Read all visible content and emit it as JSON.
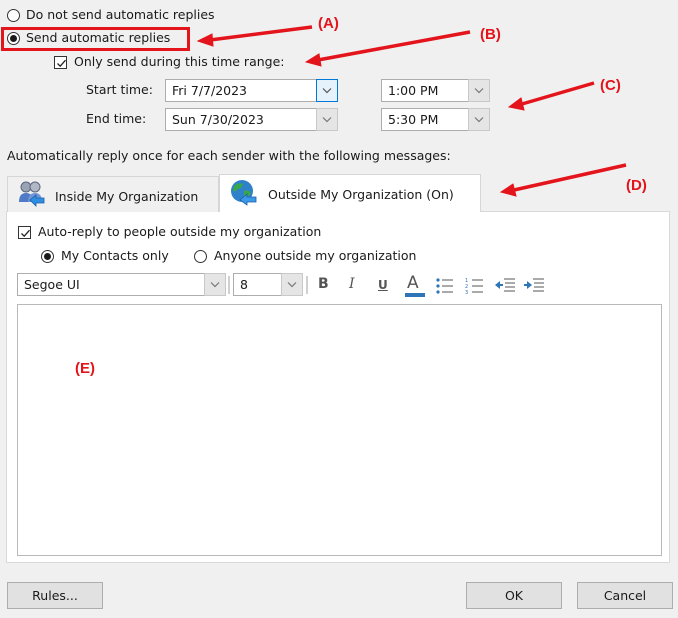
{
  "reply_mode": {
    "options": [
      {
        "label": "Do not send automatic replies",
        "selected": false
      },
      {
        "label": "Send automatic replies",
        "selected": true
      }
    ],
    "time_range": {
      "label": "Only send during this time range:",
      "checked": true,
      "start": {
        "label": "Start time:",
        "date": "Fri 7/7/2023",
        "time": "1:00 PM"
      },
      "end": {
        "label": "End time:",
        "date": "Sun 7/30/2023",
        "time": "5:30 PM"
      }
    }
  },
  "messages_label": "Automatically reply once for each sender with the following messages:",
  "tabs": [
    {
      "label": "Inside My Organization",
      "icon": "people-icon",
      "active": false
    },
    {
      "label": "Outside My Organization (On)",
      "icon": "globe-icon",
      "active": true
    }
  ],
  "outside": {
    "auto_reply_label": "Auto-reply to people outside my organization",
    "auto_reply_checked": true,
    "audience": [
      {
        "label": "My Contacts only",
        "selected": true
      },
      {
        "label": "Anyone outside my organization",
        "selected": false
      }
    ]
  },
  "formatting": {
    "font": "Segoe UI",
    "size": "8",
    "bold": "B",
    "italic": "I",
    "underline": "U",
    "font_color": "A",
    "font_color_hex": "#2e75b6"
  },
  "editor": {
    "content": ""
  },
  "buttons": {
    "rules": "Rules...",
    "ok": "OK",
    "cancel": "Cancel"
  },
  "annotations": {
    "a": "(A)",
    "b": "(B)",
    "c": "(C)",
    "d": "(D)",
    "e": "(E)",
    "color": "#e3141b"
  }
}
